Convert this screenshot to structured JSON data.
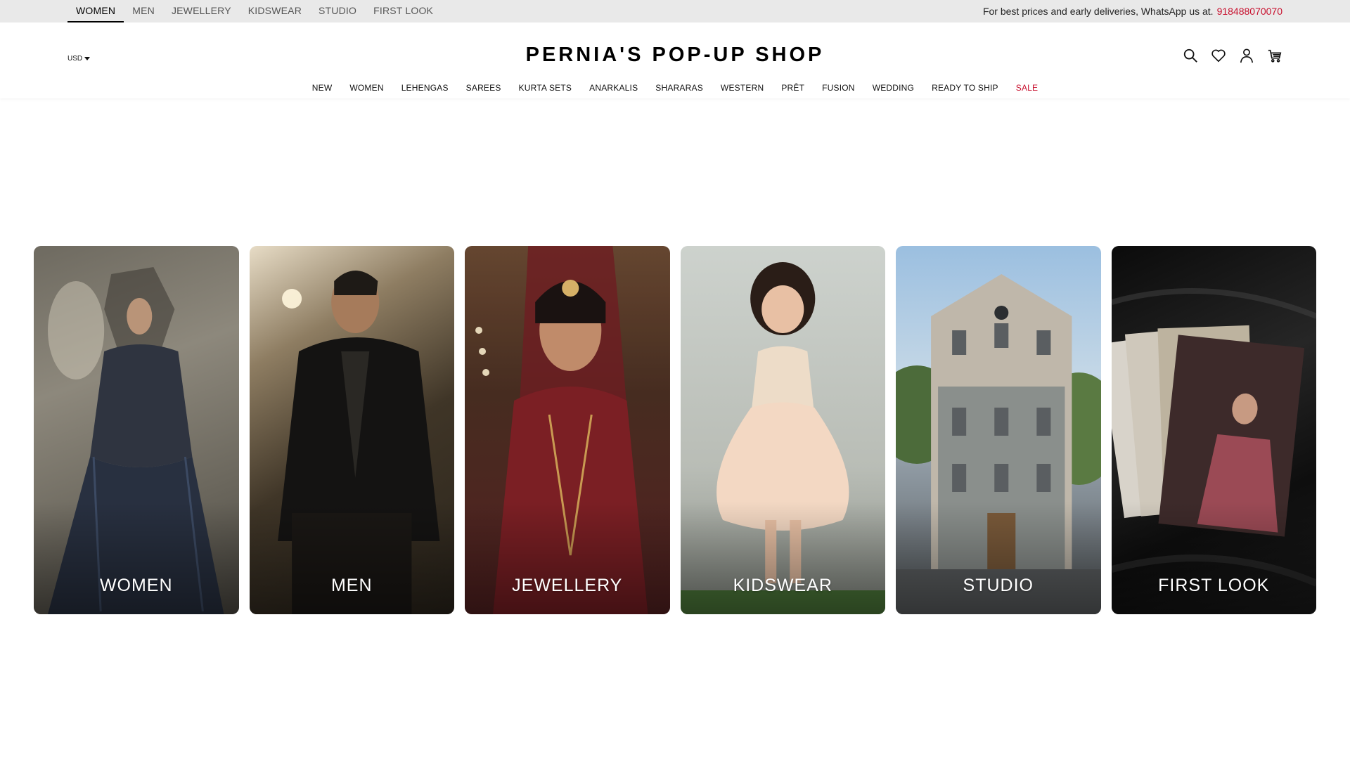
{
  "topbar": {
    "sections": [
      {
        "label": "WOMEN",
        "active": true
      },
      {
        "label": "MEN",
        "active": false
      },
      {
        "label": "JEWELLERY",
        "active": false
      },
      {
        "label": "KIDSWEAR",
        "active": false
      },
      {
        "label": "STUDIO",
        "active": false
      },
      {
        "label": "FIRST LOOK",
        "active": false
      }
    ],
    "promo_text": "For best prices and early deliveries, WhatsApp us at.",
    "promo_phone": "918488070070"
  },
  "header": {
    "currency": "USD",
    "logo": "PERNIA'S POP-UP SHOP",
    "icons": [
      "search-icon",
      "heart-icon",
      "user-icon",
      "cart-icon"
    ]
  },
  "main_nav": [
    {
      "label": "NEW"
    },
    {
      "label": "WOMEN"
    },
    {
      "label": "LEHENGAS"
    },
    {
      "label": "SAREES"
    },
    {
      "label": "KURTA SETS"
    },
    {
      "label": "ANARKALIS"
    },
    {
      "label": "SHARARAS"
    },
    {
      "label": "WESTERN"
    },
    {
      "label": "PRÊT"
    },
    {
      "label": "FUSION"
    },
    {
      "label": "WEDDING"
    },
    {
      "label": "READY TO SHIP"
    },
    {
      "label": "SALE",
      "highlight": true
    }
  ],
  "category_cards": [
    {
      "label": "WOMEN"
    },
    {
      "label": "MEN"
    },
    {
      "label": "JEWELLERY"
    },
    {
      "label": "KIDSWEAR"
    },
    {
      "label": "STUDIO"
    },
    {
      "label": "FIRST LOOK"
    }
  ],
  "colors": {
    "topbar_bg": "#e9e9e9",
    "accent_red": "#c8102e",
    "text": "#111111"
  }
}
